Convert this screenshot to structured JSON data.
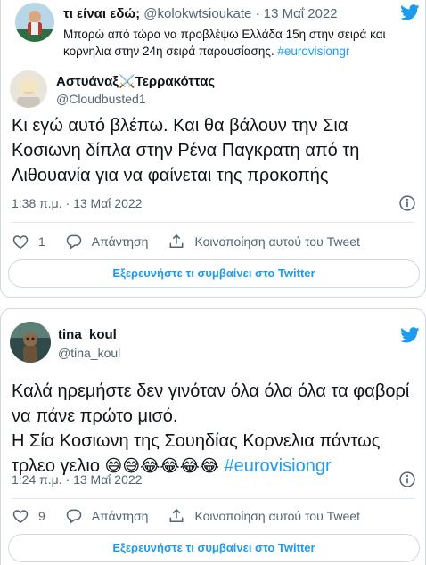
{
  "tweet1": {
    "quoted": {
      "name": "τι είναι εδώ;",
      "handle_date": "@kolokwtsioukate · 13 Μαΐ 2022",
      "text": "Μπορώ από τώρα να προβλέψω Ελλάδα 15η στην σειρά και κορνηλια στην 24η σειρά παρουσίασης.",
      "hashtag": "#eurovisiongr"
    },
    "author": {
      "name_prefix": "Αστυάναξ",
      "name_emoji": "⚔️",
      "name_suffix": "Τερρακόττας",
      "handle": "@Cloudbusted1"
    },
    "text": "Κι εγώ αυτό βλέπω. Και θα βάλουν την Σια Κοσιωνη δίπλα στην Ρένα Παγκρατη από τη Λιθουανία για να φαίνεται της προκοπής",
    "timestamp": "1:38 π.μ. · 13 Μαΐ 2022",
    "like_count": "1",
    "reply_label": "Απάντηση",
    "share_label": "Κοινοποίηση αυτού του Tweet",
    "explore_label": "Εξερευνήστε τι συμβαίνει στο Twitter"
  },
  "tweet2": {
    "author": {
      "name": "tina_koul",
      "handle": "@tina_koul"
    },
    "text_line1": "Καλά ηρεμήστε δεν γινόταν όλα όλα όλα τα φαβορί να πάνε πρώτο μισό.",
    "text_line2": "Η Σία Κοσιωνη της Σουηδίας Κορνελια πάντως τρλεο γελιο",
    "emojis": "😅😅😂😂😂😂",
    "hashtag": "#eurovisiongr",
    "timestamp": "1:24 π.μ. · 13 Μαΐ 2022",
    "like_count": "9",
    "reply_label": "Απάντηση",
    "share_label": "Κοινοποίηση αυτού του Tweet",
    "explore_label": "Εξερευνήστε τι συμβαίνει στο Twitter"
  },
  "colors": {
    "twitter_blue": "#1d9bf0",
    "text": "#0f1419",
    "secondary": "#536471",
    "border": "#cfd9de"
  },
  "icons": [
    "twitter-bird-icon",
    "info-icon",
    "heart-icon",
    "reply-icon",
    "share-icon"
  ]
}
